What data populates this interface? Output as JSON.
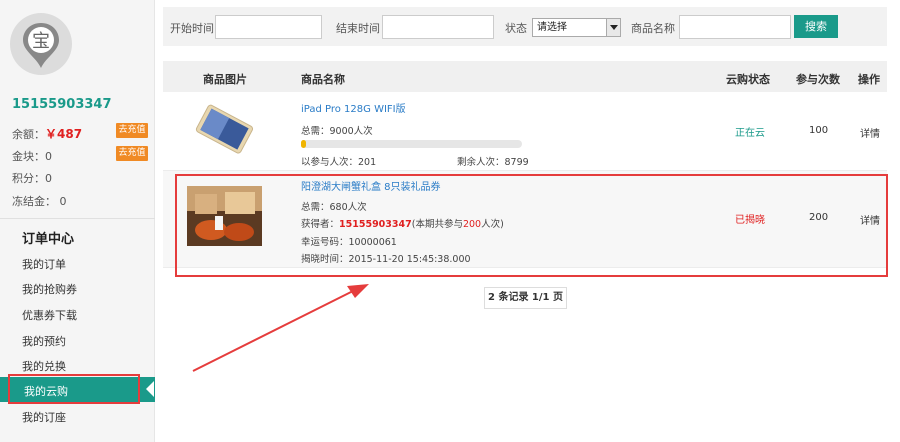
{
  "sidebar": {
    "avatar_char": "宝",
    "username": "15155903347",
    "balance_label": "余额：",
    "balance_value": "￥487",
    "gold_label": "金块：",
    "gold_value": "0",
    "points_label": "积分：",
    "points_value": "0",
    "frozen_label": "冻结金：",
    "frozen_value": "0",
    "recharge_label": "去充值",
    "order_center": "订单中心",
    "nav": [
      "我的订单",
      "我的抢购券",
      "优惠券下载",
      "我的预约",
      "我的兑换",
      "我的云购",
      "我的订座"
    ],
    "active_nav_index": 5
  },
  "filter": {
    "start_label": "开始时间",
    "start_value": "",
    "end_label": "结束时间",
    "end_value": "",
    "status_label": "状态",
    "status_selected": "请选择",
    "product_label": "商品名称",
    "product_value": "",
    "search_label": "搜索"
  },
  "table": {
    "headers": [
      "商品图片",
      "商品名称",
      "云购状态",
      "参与次数",
      "操作"
    ],
    "rows": [
      {
        "title": "iPad Pro 128G WIFI版",
        "need": "总需：9000人次",
        "progress_fraction": 0.022,
        "joined": "以参与人次：201",
        "remaining": "剩余人次：8799",
        "status": "正在云",
        "count": "100",
        "action": "详情"
      },
      {
        "title": "阳澄湖大闸蟹礼盒 8只装礼品券",
        "need": "总需：680人次",
        "winner_label": "获得者：",
        "winner_name": "15155903347",
        "winner_note_pre": "(本期共参与",
        "winner_note_num": "200",
        "winner_note_post": "人次)",
        "lucky_no": "幸运号码：10000061",
        "reveal_time": "揭晓时间：2015-11-20 15:45:38.000",
        "status": "已揭晓",
        "count": "200",
        "action": "详情"
      }
    ]
  },
  "pager": {
    "text": "2 条记录 1/1 页"
  },
  "colors": {
    "accent": "#1a9a8a",
    "red": "#e02020",
    "link": "#2a7cc7",
    "annotation": "#e53c3c",
    "recharge": "#f08a24"
  }
}
